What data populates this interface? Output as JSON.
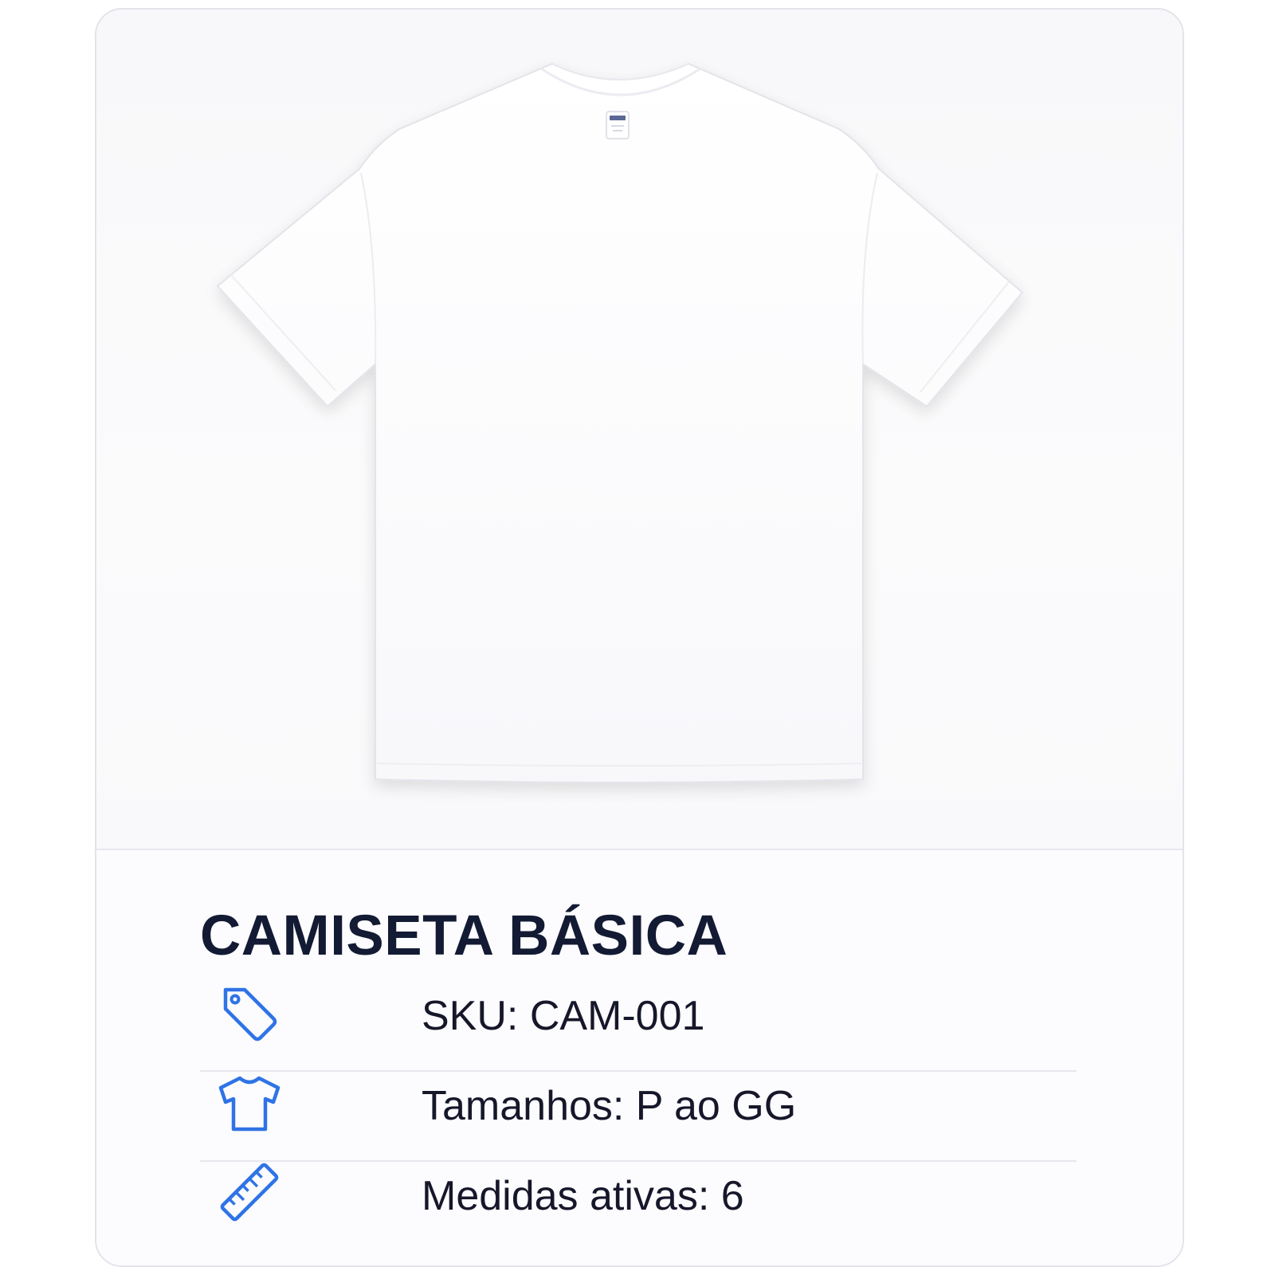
{
  "product": {
    "title": "CAMISETA BÁSICA",
    "image_icon": "tshirt-photo",
    "details": [
      {
        "icon": "tag-icon",
        "text": "SKU: CAM-001"
      },
      {
        "icon": "tshirt-icon",
        "text": "Tamanhos: P ao GG"
      },
      {
        "icon": "ruler-icon",
        "text": "Medidas ativas: 6"
      }
    ]
  },
  "colors": {
    "accent": "#2f73e6",
    "title": "#131a33",
    "text": "#16172a"
  }
}
